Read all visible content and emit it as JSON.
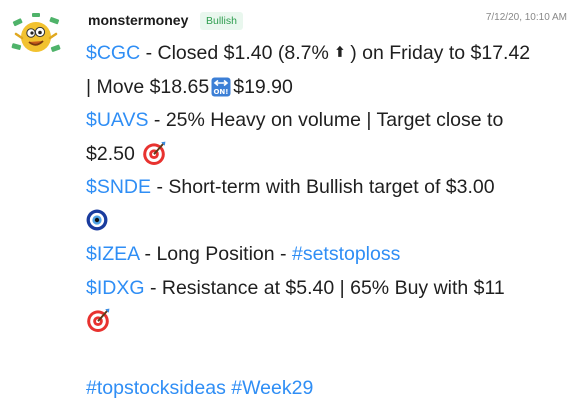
{
  "post": {
    "username": "monstermoney",
    "badge": "Bullish",
    "timestamp": "7/12/20, 10:10 AM"
  },
  "lines": {
    "l1_ticker": "$CGC",
    "l1_text": " - Closed $1.40 (8.7% ",
    "l1_text2": ") on Friday to $17.42",
    "l2_text": "| Move $18.65",
    "l2_text2": "$19.90",
    "l3_ticker": "$UAVS",
    "l3_text": " - 25% Heavy on volume | Target close to",
    "l4_text": "$2.50",
    "l5_ticker": "$SNDE",
    "l5_text": " - Short-term with Bullish target of $3.00",
    "l7_ticker": "$IZEA",
    "l7_text": " - Long Position - ",
    "l7_hashtag": "#setstoploss",
    "l8_ticker": "$IDXG",
    "l8_text": " - Resistance at $5.40 | 65% Buy with $11",
    "l10_hashtag1": "#topstocksideas",
    "l10_hashtag2": "#Week29"
  },
  "icons": {
    "avatar": "monster-avatar-icon",
    "up_arrow": "up-arrow-emoji",
    "on_arrow": "on-arrow-emoji",
    "target": "direct-hit-emoji",
    "evil_eye": "nazar-amulet-emoji"
  },
  "colors": {
    "link": "#2f8ef5",
    "badge_text": "#2e9e4f",
    "badge_bg": "#e9f7ee"
  }
}
